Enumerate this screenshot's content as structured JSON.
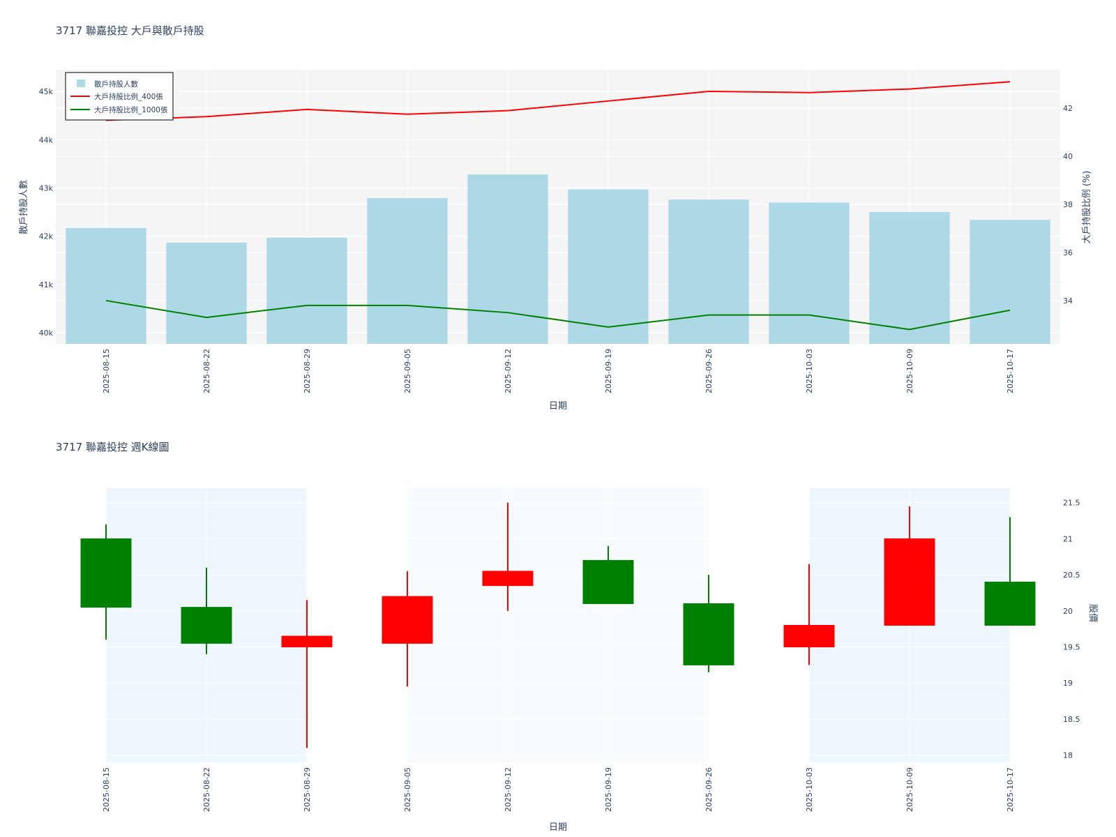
{
  "colors": {
    "bar": "#add8e6",
    "line400": "#ff0000",
    "line1000": "#008000",
    "up": "#ff0000",
    "down": "#008000",
    "plot_bg": "#f5f5f5",
    "band": "#eef7fd",
    "band_light": "#f7fbfe",
    "text": "#2a3f5f",
    "left_axis": "#add8e6",
    "right_axis": "#ff0000"
  },
  "chart_data": [
    {
      "type": "bar",
      "title": "3717 聯嘉投控 大戶與散戶持股",
      "xlabel": "日期",
      "ylabel": "散戶持股人數",
      "y2label": "大戶持股比例 (%)",
      "categories": [
        "2025-08-15",
        "2025-08-22",
        "2025-08-29",
        "2025-09-05",
        "2025-09-12",
        "2025-09-19",
        "2025-09-26",
        "2025-10-03",
        "2025-10-09",
        "2025-10-17"
      ],
      "ylim": [
        39770,
        45450
      ],
      "y_ticks": [
        40000,
        41000,
        42000,
        43000,
        44000,
        45000
      ],
      "y_tick_labels": [
        "40k",
        "41k",
        "42k",
        "43k",
        "44k",
        "45k"
      ],
      "y2lim": [
        32.2,
        43.6
      ],
      "y2_ticks": [
        34,
        36,
        38,
        40,
        42
      ],
      "y2_tick_labels": [
        "34",
        "36",
        "38",
        "40",
        "42"
      ],
      "legend_position": "top-left",
      "series": [
        {
          "name": "散戶持股人數",
          "kind": "bar",
          "axis": "y",
          "values": [
            42170,
            41870,
            41970,
            42790,
            43280,
            42970,
            42760,
            42700,
            42500,
            42340
          ]
        },
        {
          "name": "大戶持股比例_400張",
          "kind": "line",
          "axis": "y2",
          "values": [
            41.5,
            41.65,
            41.95,
            41.75,
            41.9,
            42.3,
            42.7,
            42.65,
            42.8,
            43.1
          ]
        },
        {
          "name": "大戶持股比例_1000張",
          "kind": "line",
          "axis": "y2",
          "values": [
            34.0,
            33.3,
            33.8,
            33.8,
            33.5,
            32.9,
            33.4,
            33.4,
            32.8,
            33.6
          ]
        }
      ]
    },
    {
      "type": "candlestick",
      "title": "3717 聯嘉投控 週K線圖",
      "xlabel": "日期",
      "ylabel": "股價",
      "categories": [
        "2025-08-15",
        "2025-08-22",
        "2025-08-29",
        "2025-09-05",
        "2025-09-12",
        "2025-09-19",
        "2025-09-26",
        "2025-10-03",
        "2025-10-09",
        "2025-10-17"
      ],
      "ylim": [
        17.9,
        21.7
      ],
      "y_ticks": [
        18,
        18.5,
        19,
        19.5,
        20,
        20.5,
        21,
        21.5
      ],
      "y_tick_labels": [
        "18",
        "18.5",
        "19",
        "19.5",
        "20",
        "20.5",
        "21",
        "21.5"
      ],
      "ohlc": [
        {
          "open": 21.0,
          "high": 21.2,
          "low": 19.6,
          "close": 20.05
        },
        {
          "open": 20.05,
          "high": 20.6,
          "low": 19.4,
          "close": 19.55
        },
        {
          "open": 19.5,
          "high": 20.15,
          "low": 18.1,
          "close": 19.65
        },
        {
          "open": 19.55,
          "high": 20.55,
          "low": 18.95,
          "close": 20.2
        },
        {
          "open": 20.35,
          "high": 21.5,
          "low": 20.0,
          "close": 20.55
        },
        {
          "open": 20.7,
          "high": 20.9,
          "low": 20.1,
          "close": 20.1
        },
        {
          "open": 20.1,
          "high": 20.5,
          "low": 19.15,
          "close": 19.25
        },
        {
          "open": 19.5,
          "high": 20.65,
          "low": 19.25,
          "close": 19.8
        },
        {
          "open": 19.8,
          "high": 21.45,
          "low": 19.8,
          "close": 21.0
        },
        {
          "open": 20.4,
          "high": 21.3,
          "low": 19.8,
          "close": 19.8
        }
      ]
    }
  ]
}
